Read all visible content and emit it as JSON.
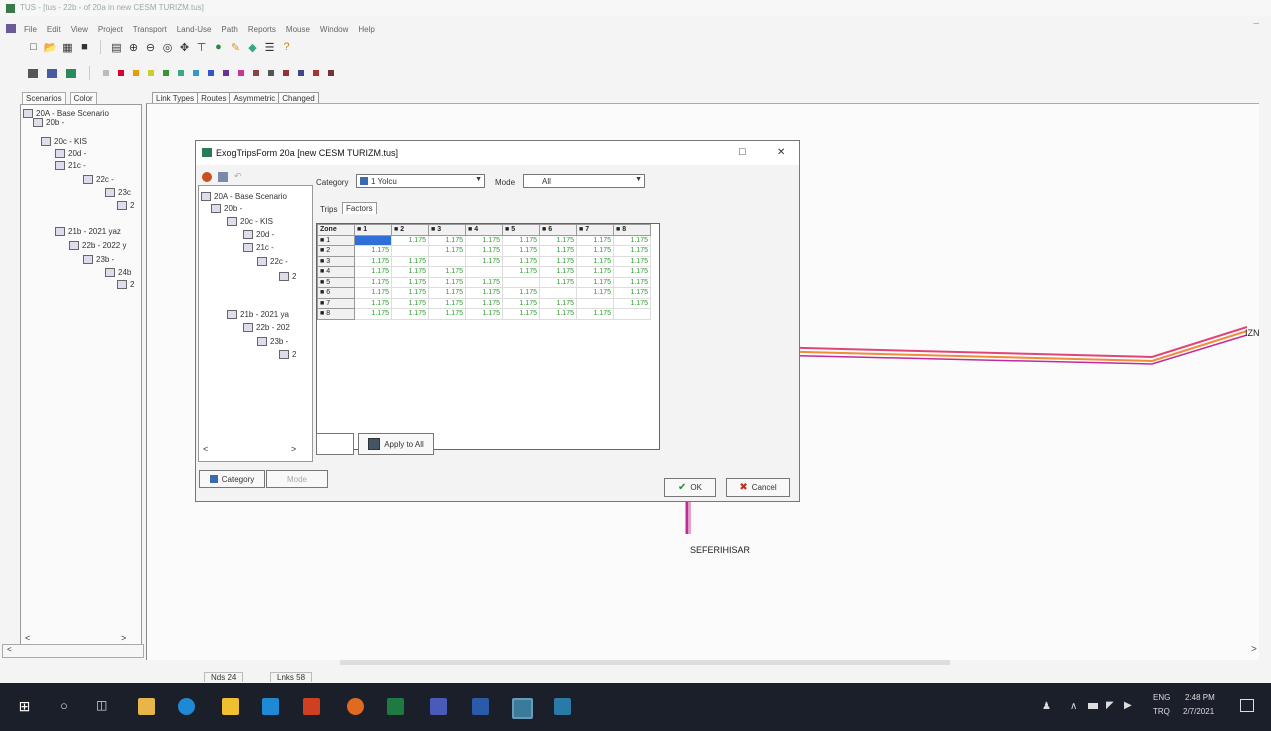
{
  "window": {
    "title": "TUS - [tus - 22b - of 20a in new CESM TURIZM.tus]",
    "controls": "–"
  },
  "menu": [
    "File",
    "Edit",
    "View",
    "Project",
    "Transport",
    "Land-Use",
    "Path",
    "Reports",
    "Mouse",
    "Window",
    "Help"
  ],
  "left_panel": {
    "tabs": [
      "Scenarios",
      "Color"
    ],
    "tree": [
      "20A - Base Scenario",
      "20b -",
      "20c - KIS",
      "20d -",
      "21c -",
      "22c -",
      "23c",
      "2",
      "21b - 2021 yaz",
      "22b - 2022 y",
      "23b -",
      "24b",
      "2"
    ]
  },
  "main_tabs": [
    "Link Types",
    "Routes",
    "Asymmetric",
    "Changed"
  ],
  "map": {
    "labels": {
      "west": "SEFERIHISAR",
      "east": "IZN"
    }
  },
  "status": {
    "nodes": "Nds 24",
    "links": "Lnks 58"
  },
  "dialog": {
    "title": "ExogTripsForm  20a [new CESM TURIZM.tus]",
    "min_label": "□",
    "close_label": "✕",
    "category_label": "Category",
    "category_value": "1 Yolcu",
    "mode_label": "Mode",
    "mode_value": "All",
    "subtabs": [
      "Trips",
      "Factors"
    ],
    "tree": [
      "20A - Base Scenario",
      "20b -",
      "20c - KIS",
      "20d -",
      "21c -",
      "22c -",
      "2",
      "21b - 2021 ya",
      "22b - 202",
      "23b -",
      "2"
    ],
    "grid": {
      "corner": "Zone",
      "cols": [
        "1",
        "2",
        "3",
        "4",
        "5",
        "6",
        "7",
        "8"
      ],
      "rows": [
        {
          "zone": "1",
          "values": [
            "",
            "1.175",
            "1.175",
            "1.175",
            "1.175",
            "1.175",
            "1.175",
            "1.175"
          ]
        },
        {
          "zone": "2",
          "values": [
            "1.175",
            "",
            "1.175",
            "1.175",
            "1.175",
            "1.175",
            "1.175",
            "1.175"
          ]
        },
        {
          "zone": "3",
          "values": [
            "1.175",
            "1.175",
            "",
            "1.175",
            "1.175",
            "1.175",
            "1.175",
            "1.175"
          ]
        },
        {
          "zone": "4",
          "values": [
            "1.175",
            "1.175",
            "1.175",
            "",
            "1.175",
            "1.175",
            "1.175",
            "1.175"
          ]
        },
        {
          "zone": "5",
          "values": [
            "1.175",
            "1.175",
            "1.175",
            "1.175",
            "",
            "1.175",
            "1.175",
            "1.175"
          ]
        },
        {
          "zone": "6",
          "values": [
            "1.175",
            "1.175",
            "1.175",
            "1.175",
            "1.175",
            "",
            "1.175",
            "1.175"
          ]
        },
        {
          "zone": "7",
          "values": [
            "1.175",
            "1.175",
            "1.175",
            "1.175",
            "1.175",
            "1.175",
            "",
            "1.175"
          ]
        },
        {
          "zone": "8",
          "values": [
            "1.175",
            "1.175",
            "1.175",
            "1.175",
            "1.175",
            "1.175",
            "1.175",
            ""
          ]
        }
      ]
    },
    "apply_label": "Apply to All",
    "bottom_tabs": [
      "Category",
      "Mode"
    ],
    "ok_label": "OK",
    "cancel_label": "Cancel"
  },
  "taskbar": {
    "lang": "ENG",
    "region": "TRQ",
    "time": "2:48 PM",
    "date": "2/7/2021"
  },
  "colors": {
    "accent": "#2f6fd8",
    "route_pink": "#e0457a",
    "route_orange": "#f08c3a",
    "route_purple": "#c02a9a",
    "grid_green": "#2a9d2a",
    "taskbar": "#1b1f2a"
  }
}
